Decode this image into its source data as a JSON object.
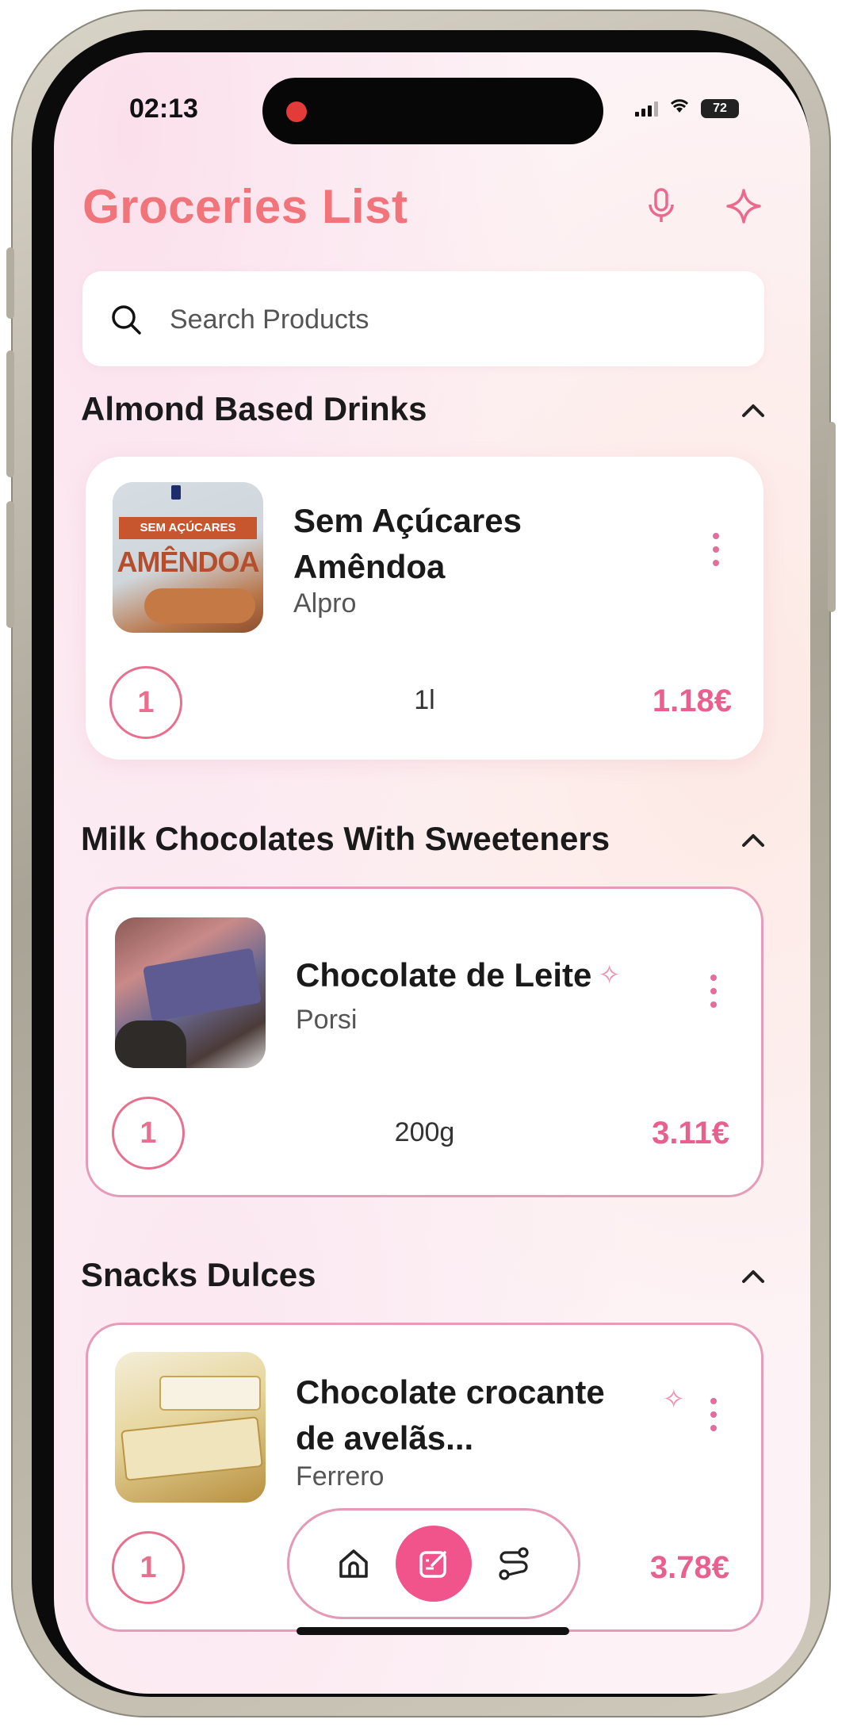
{
  "status_bar": {
    "time": "02:13",
    "battery": "72"
  },
  "header": {
    "title": "Groceries List",
    "mic_icon": "mic-icon",
    "sparkle_icon": "sparkle-icon"
  },
  "search": {
    "placeholder": "Search Products"
  },
  "colors": {
    "accent": "#f0747a",
    "price": "#e8618e",
    "card_border": "#e69bb8",
    "nav_active": "#f0548a"
  },
  "sections": [
    {
      "title": "Almond Based Drinks",
      "items": [
        {
          "name_line1": "Sem Açúcares",
          "name_line2": "Amêndoa",
          "brand": "Alpro",
          "quantity": "1",
          "unit": "1l",
          "price": "1.18€",
          "image_text_top": "SEM AÇÚCARES",
          "image_text_main": "AMÊNDOA"
        }
      ]
    },
    {
      "title": "Milk Chocolates With Sweeteners",
      "items": [
        {
          "name_line1": "Chocolate de Leite",
          "brand": "Porsi",
          "quantity": "1",
          "unit": "200g",
          "price": "3.11€"
        }
      ]
    },
    {
      "title": "Snacks Dulces",
      "items": [
        {
          "name_line1": "Chocolate crocante",
          "name_line2": "de avelãs...",
          "brand": "Ferrero",
          "quantity": "1",
          "price": "3.78€"
        }
      ]
    }
  ],
  "navbar": {
    "items": [
      "home-icon",
      "list-edit-icon",
      "route-icon"
    ],
    "active_index": 1
  }
}
